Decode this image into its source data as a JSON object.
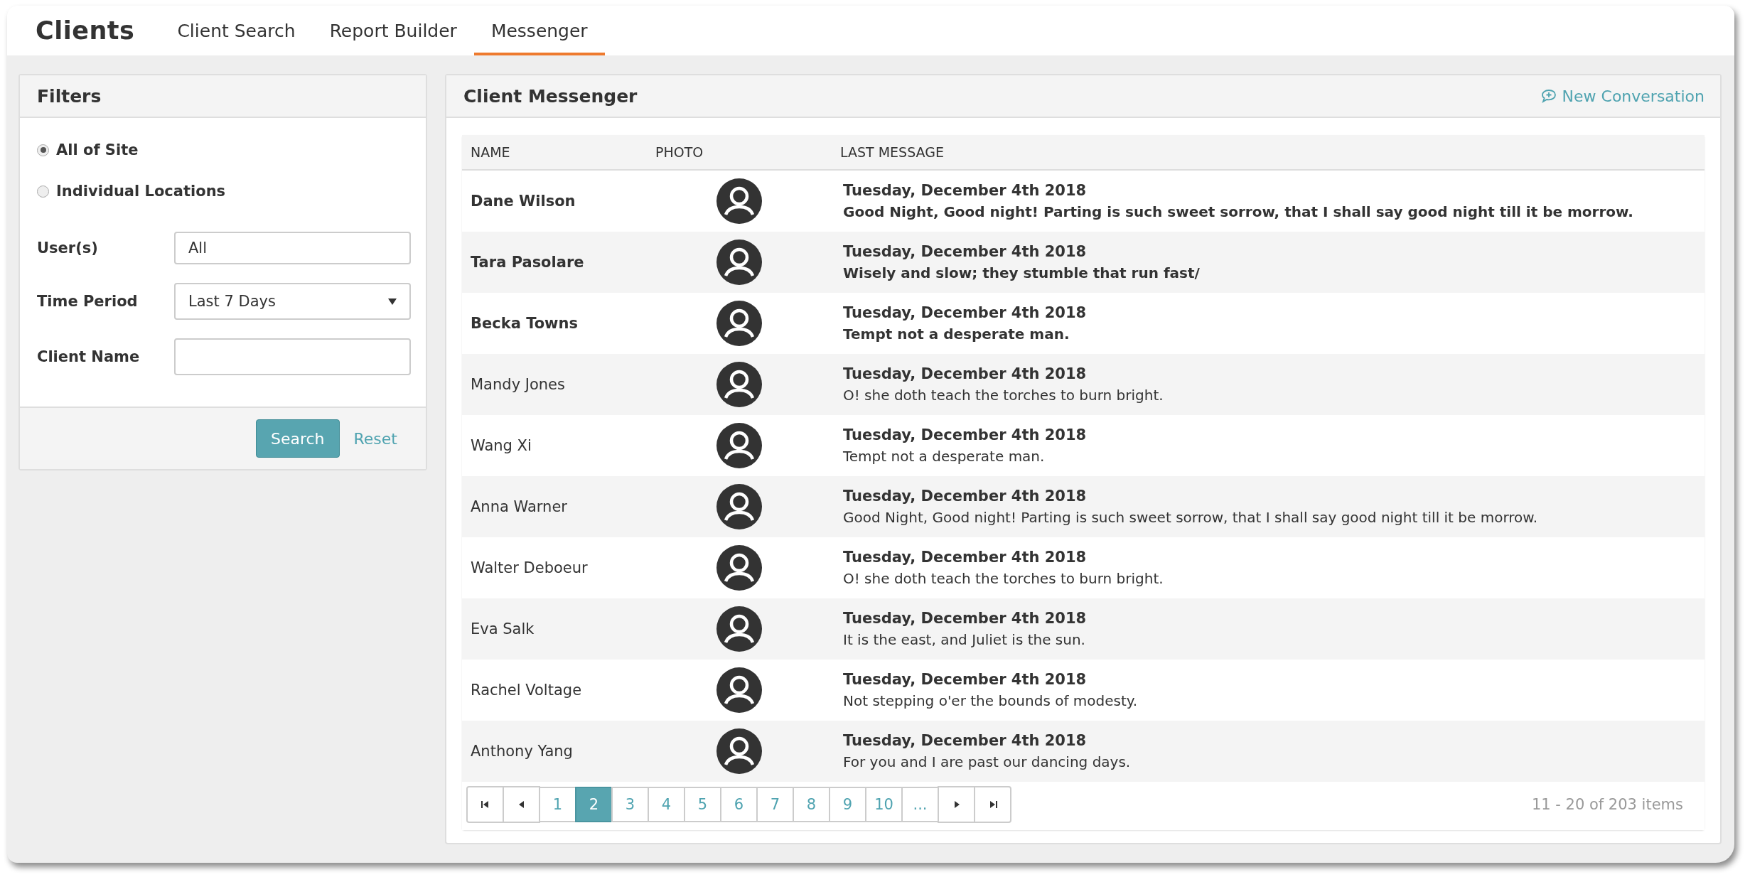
{
  "app_title": "Clients",
  "tabs": [
    {
      "label": "Client Search",
      "selected": false
    },
    {
      "label": "Report Builder",
      "selected": false
    },
    {
      "label": "Messenger",
      "selected": true
    }
  ],
  "filters": {
    "title": "Filters",
    "scope_options": [
      {
        "label": "All of Site",
        "selected": true
      },
      {
        "label": "Individual Locations",
        "selected": false
      }
    ],
    "fields": [
      {
        "kind": "text",
        "label": "User(s)",
        "value": "All"
      },
      {
        "kind": "select",
        "label": "Time Period",
        "value": "Last 7 Days"
      },
      {
        "kind": "text",
        "label": "Client Name"
      }
    ],
    "search_button": "Search",
    "reset_link": "Reset"
  },
  "messenger": {
    "title": "Client Messenger",
    "new_conversation": "New Conversation",
    "table": {
      "columns": [
        "NAME",
        "PHOTO",
        "LAST MESSAGE"
      ],
      "rows": [
        {
          "name": "Dane Wilson",
          "unread": true,
          "date": "Tuesday, December 4th 2018",
          "message": "Good Night, Good night! Parting is such sweet sorrow, that I shall say good night till it be morrow."
        },
        {
          "name": "Tara Pasolare",
          "unread": true,
          "date": "Tuesday, December 4th 2018",
          "message": "Wisely and slow; they stumble that run fast/"
        },
        {
          "name": "Becka Towns",
          "unread": true,
          "date": "Tuesday, December 4th 2018",
          "message": "Tempt not a desperate man."
        },
        {
          "name": "Mandy Jones",
          "unread": false,
          "date": "Tuesday, December 4th 2018",
          "message": "O! she doth teach the torches to burn bright."
        },
        {
          "name": "Wang Xi",
          "unread": false,
          "date": "Tuesday, December 4th 2018",
          "message": "Tempt not a desperate man."
        },
        {
          "name": "Anna Warner",
          "unread": false,
          "date": "Tuesday, December 4th 2018",
          "message": "Good Night, Good night! Parting is such sweet sorrow, that I shall say good night till it be morrow."
        },
        {
          "name": "Walter Deboeur",
          "unread": false,
          "date": "Tuesday, December 4th 2018",
          "message": "O! she doth teach the torches to burn bright."
        },
        {
          "name": "Eva Salk",
          "unread": false,
          "date": "Tuesday, December 4th 2018",
          "message": "It is the east, and Juliet is the sun."
        },
        {
          "name": "Rachel Voltage",
          "unread": false,
          "date": "Tuesday, December 4th 2018",
          "message": "Not stepping o'er the bounds of modesty."
        },
        {
          "name": "Anthony Yang",
          "unread": false,
          "date": "Tuesday, December 4th 2018",
          "message": "For you and I are past our dancing days."
        }
      ]
    },
    "pagination": {
      "pages": [
        {
          "label": "1",
          "selected": false
        },
        {
          "label": "2",
          "selected": true
        },
        {
          "label": "3",
          "selected": false
        },
        {
          "label": "4",
          "selected": false
        },
        {
          "label": "5",
          "selected": false
        },
        {
          "label": "6",
          "selected": false
        },
        {
          "label": "7",
          "selected": false
        },
        {
          "label": "8",
          "selected": false
        },
        {
          "label": "9",
          "selected": false
        },
        {
          "label": "10",
          "selected": false
        },
        {
          "label": "...",
          "selected": false
        }
      ],
      "summary": "11 - 20 of 203 items"
    }
  }
}
